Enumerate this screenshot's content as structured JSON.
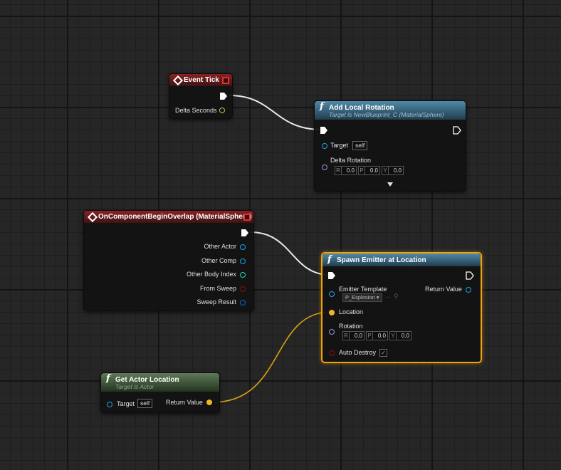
{
  "colors": {
    "exec": "#ffffff",
    "object_pin": "#1ea0e8",
    "primitive_comp_pin": "#1ea0e8",
    "int_pin": "#1ed8a8",
    "bool_pin": "#8a1010",
    "struct_pin": "#1060d0",
    "vector_pin": "#f0b428",
    "rotator_pin": "#8a9ad8",
    "float_pin": "#9ad848",
    "selected_border": "#f0a20b",
    "event_header": "#8a2222",
    "function_header": "#4e8aa8",
    "pure_header": "#5e7a58"
  },
  "event_tick": {
    "title": "Event Tick",
    "pin_delta": "Delta Seconds"
  },
  "add_local_rotation": {
    "title": "Add Local Rotation",
    "subtitle": "Target is NewBlueprint_C (MaterialSphere)",
    "pin_target": "Target",
    "target_value": "self",
    "pin_delta_rotation": "Delta Rotation",
    "rotation": {
      "r_label": "R",
      "r": "0.0",
      "p_label": "P",
      "p": "0.0",
      "y_label": "Y",
      "y": "0.0"
    },
    "expand_icon": "chevron-down-icon"
  },
  "overlap_event": {
    "title": "OnComponentBeginOverlap (MaterialSphere)",
    "pins": [
      "Other Actor",
      "Other Comp",
      "Other Body Index",
      "From Sweep",
      "Sweep Result"
    ]
  },
  "spawn_emitter": {
    "title": "Spawn Emitter at Location",
    "pin_emitter": "Emitter Template",
    "emitter_value": "P_Explosion",
    "pin_return": "Return Value",
    "pin_location": "Location",
    "pin_rotation": "Rotation",
    "rotation": {
      "r_label": "R",
      "r": "0.0",
      "p_label": "P",
      "p": "0.0",
      "y_label": "Y",
      "y": "0.0"
    },
    "pin_auto_destroy": "Auto Destroy",
    "auto_destroy_checked": true,
    "auto_destroy_mark": "✓"
  },
  "get_actor_location": {
    "title": "Get Actor Location",
    "subtitle": "Target is Actor",
    "pin_target": "Target",
    "target_value": "self",
    "pin_return": "Return Value"
  }
}
